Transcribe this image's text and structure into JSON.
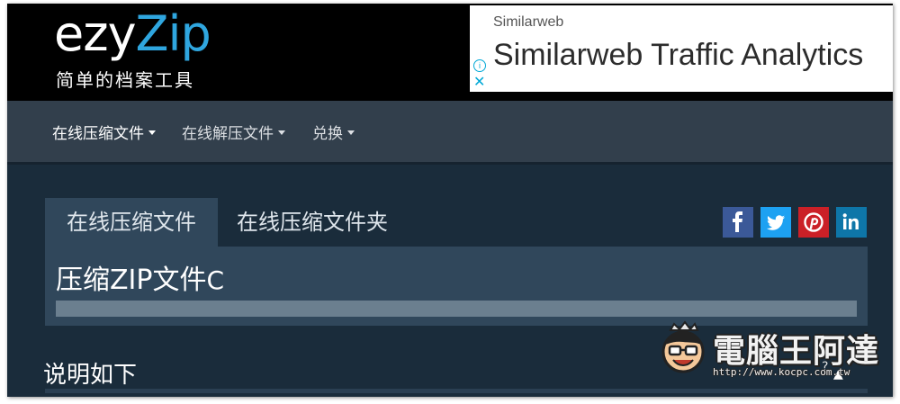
{
  "header": {
    "logo_part1": "ezy",
    "logo_part2": "Zip",
    "tagline": "简单的档案工具",
    "ad": {
      "brand": "Similarweb",
      "title": "Similarweb Traffic Analytics",
      "info_glyph": "i",
      "close_glyph": "✕"
    }
  },
  "nav": {
    "items": [
      {
        "label": "在线压缩文件",
        "active": true
      },
      {
        "label": "在线解压文件",
        "active": false
      },
      {
        "label": "兑换",
        "active": false
      }
    ]
  },
  "main": {
    "tabs": [
      {
        "label": "在线压缩文件",
        "active": true
      },
      {
        "label": "在线压缩文件夹",
        "active": false
      }
    ],
    "panel_title": "压缩ZIP文件",
    "panel_title_suffix": "C",
    "description_heading": "说明如下",
    "question_glyph": "?",
    "share_buttons": [
      {
        "icon": "facebook-icon",
        "color": "#3b5998"
      },
      {
        "icon": "twitter-icon",
        "color": "#1da1f2"
      },
      {
        "icon": "pinterest-icon",
        "color": "#cb2027"
      },
      {
        "icon": "linkedin-icon",
        "color": "#0e76a8"
      }
    ]
  },
  "watermark": {
    "title": "電腦王阿達",
    "url": "http://www.kocpc.com.tw"
  },
  "colors": {
    "accent": "#2fa6df",
    "nav_bg": "#323f4c",
    "page_bg": "#1a2c3b",
    "panel_bg": "#30475b"
  }
}
